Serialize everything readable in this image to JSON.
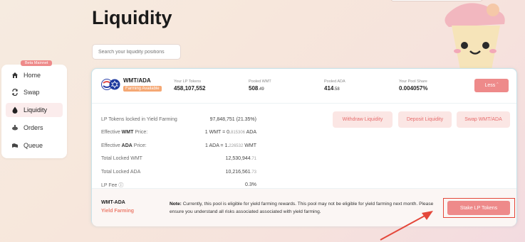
{
  "page": {
    "title": "Liquidity"
  },
  "search": {
    "placeholder": "Search your liquidity positions"
  },
  "sidebar": {
    "badge": "Beta Mainnet",
    "items": [
      {
        "label": "Home",
        "icon": "home-icon"
      },
      {
        "label": "Swap",
        "icon": "swap-icon"
      },
      {
        "label": "Liquidity",
        "icon": "liquidity-drop-icon",
        "active": true
      },
      {
        "label": "Orders",
        "icon": "orders-icon"
      },
      {
        "label": "Queue",
        "icon": "queue-icon"
      }
    ]
  },
  "position": {
    "pair": "WMT/ADA",
    "badge": "Farming Available",
    "stats": [
      {
        "label": "Your LP Tokens",
        "value": "458,107,552",
        "decimals": ""
      },
      {
        "label": "Pooled WMT",
        "value": "508",
        "decimals": ".49"
      },
      {
        "label": "Pooled ADA",
        "value": "414",
        "decimals": ".58"
      },
      {
        "label": "Your Pool Share",
        "value": "0.004057%",
        "decimals": ""
      }
    ],
    "less_label": "Less",
    "details": {
      "lp_locked_label": "LP Tokens locked in Yield Farming",
      "lp_locked_value": "97,848,751 (21.35%)",
      "eff_wmt_prefix": "Effective",
      "eff_wmt_token": "WMT",
      "eff_wmt_suffix": "Price:",
      "eff_wmt_value_a": "1 WMT = 0.",
      "eff_wmt_value_b": "815306",
      "eff_wmt_value_c": "ADA",
      "eff_ada_prefix": "Effective",
      "eff_ada_token": "ADA",
      "eff_ada_suffix": "Price:",
      "eff_ada_value_a": "1 ADA = 1.",
      "eff_ada_value_b": "226532",
      "eff_ada_value_c": "WMT",
      "locked_wmt_label": "Total Locked WMT",
      "locked_wmt_value": "12,530,944",
      "locked_wmt_dec": ".71",
      "locked_ada_label": "Total Locked ADA",
      "locked_ada_value": "10,216,561",
      "locked_ada_dec": ".73",
      "fee_label": "LP Fee",
      "fee_value": "0.3%"
    },
    "actions": {
      "withdraw": "Withdraw Liquidity",
      "deposit": "Deposit Liquidity",
      "swap": "Swap WMT/ADA"
    },
    "footer": {
      "pair": "WMT-ADA",
      "sub": "Yield Farming",
      "note_bold": "Note:",
      "note_text": "Currently, this pool is eligible for yield farming rewards. This pool may not be eligible for yield farming next month. Please ensure you understand all risks associated associated with yield farming.",
      "stake": "Stake LP Tokens"
    }
  },
  "colors": {
    "accent": "#ee8a8a",
    "highlight": "#e4473a",
    "badge": "#f5a874"
  }
}
